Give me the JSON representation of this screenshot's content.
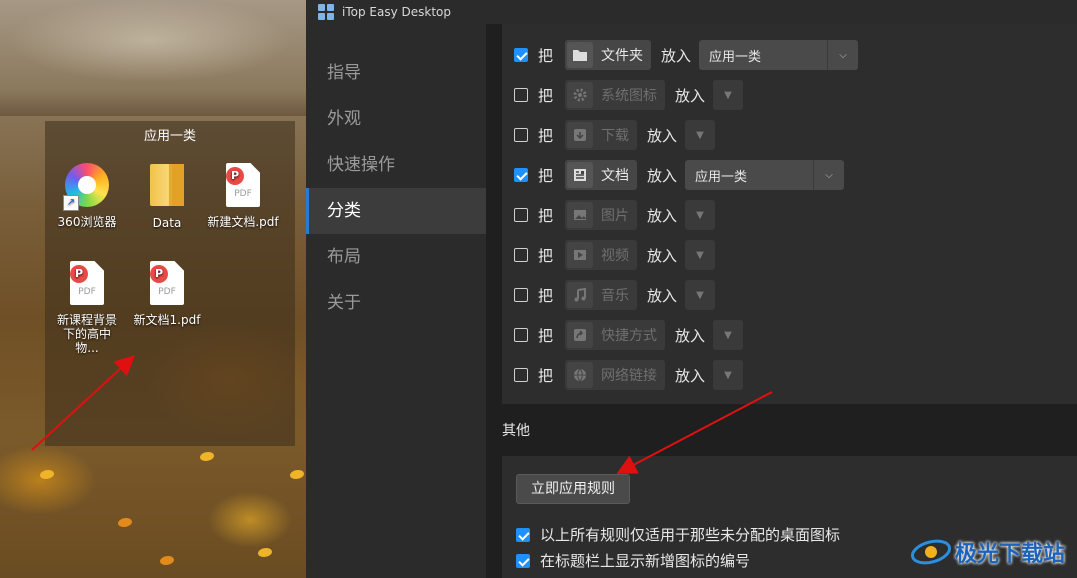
{
  "desktop": {
    "fence_title": "应用一类",
    "icons": [
      {
        "label": "360浏览器",
        "icon": "360-browser-icon"
      },
      {
        "label": "Data",
        "icon": "folder-icon"
      },
      {
        "label": "新建文档.pdf",
        "icon": "pdf-icon"
      },
      {
        "label": "新课程背景下的高中物...",
        "icon": "pdf-icon"
      },
      {
        "label": "新文档1.pdf",
        "icon": "pdf-icon"
      }
    ],
    "pdf_icon_text": "PDF"
  },
  "app": {
    "title": "iTop Easy Desktop",
    "nav": [
      {
        "label": "指导",
        "active": false
      },
      {
        "label": "外观",
        "active": false
      },
      {
        "label": "快速操作",
        "active": false
      },
      {
        "label": "分类",
        "active": true
      },
      {
        "label": "布局",
        "active": false
      },
      {
        "label": "关于",
        "active": false
      }
    ],
    "rule_word": "把",
    "put_word": "放入",
    "rules": [
      {
        "checked": true,
        "category": "文件夹",
        "icon": "folder-icon",
        "target": "应用一类"
      },
      {
        "checked": false,
        "category": "系统图标",
        "icon": "gear-icon",
        "target": ""
      },
      {
        "checked": false,
        "category": "下载",
        "icon": "download-icon",
        "target": ""
      },
      {
        "checked": true,
        "category": "文档",
        "icon": "document-icon",
        "target": "应用一类"
      },
      {
        "checked": false,
        "category": "图片",
        "icon": "image-icon",
        "target": ""
      },
      {
        "checked": false,
        "category": "视频",
        "icon": "video-icon",
        "target": ""
      },
      {
        "checked": false,
        "category": "音乐",
        "icon": "music-icon",
        "target": ""
      },
      {
        "checked": false,
        "category": "快捷方式",
        "icon": "shortcut-icon",
        "target": ""
      },
      {
        "checked": false,
        "category": "网络链接",
        "icon": "globe-icon",
        "target": ""
      }
    ],
    "other": {
      "title": "其他",
      "apply_button": "立即应用规则",
      "options": [
        {
          "checked": true,
          "label": "以上所有规则仅适用于那些未分配的桌面图标"
        },
        {
          "checked": true,
          "label": "在标题栏上显示新增图标的编号"
        }
      ]
    }
  },
  "watermark": {
    "text": "极光下载站"
  },
  "colors": {
    "accent": "#1e90ff",
    "arrow": "#e01010",
    "active_nav_bar": "#2b79d6"
  }
}
